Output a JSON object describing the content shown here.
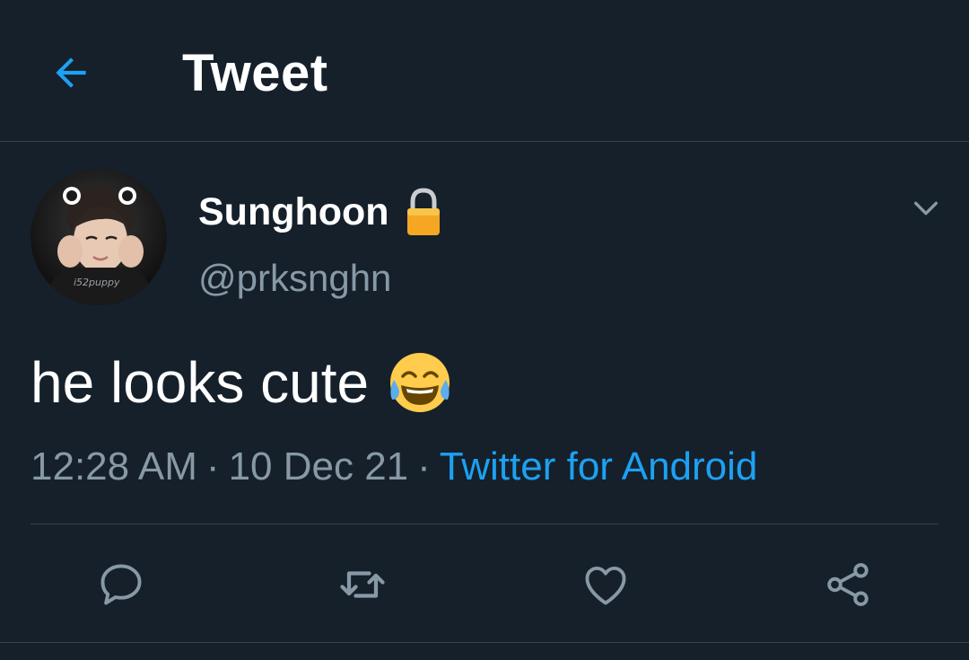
{
  "header": {
    "title": "Tweet",
    "back_icon": "arrow-left-icon"
  },
  "tweet": {
    "author": {
      "display_name": "Sunghoon",
      "handle": "@prksnghn",
      "protected_icon": "lock-icon",
      "avatar_watermark": "i52puppy"
    },
    "text": "he looks cute",
    "emoji": "face-with-tears-of-joy",
    "time": "12:28 AM",
    "separator": "·",
    "date": "10 Dec 21",
    "source": "Twitter for Android"
  },
  "actions": [
    {
      "name": "reply",
      "icon": "reply-icon"
    },
    {
      "name": "retweet",
      "icon": "retweet-icon"
    },
    {
      "name": "like",
      "icon": "heart-icon"
    },
    {
      "name": "share",
      "icon": "share-icon"
    }
  ],
  "colors": {
    "background": "#15202b",
    "accent": "#1da1f2",
    "secondary_text": "#8899a6",
    "divider": "#38444d",
    "icon_muted": "#8899a6"
  }
}
